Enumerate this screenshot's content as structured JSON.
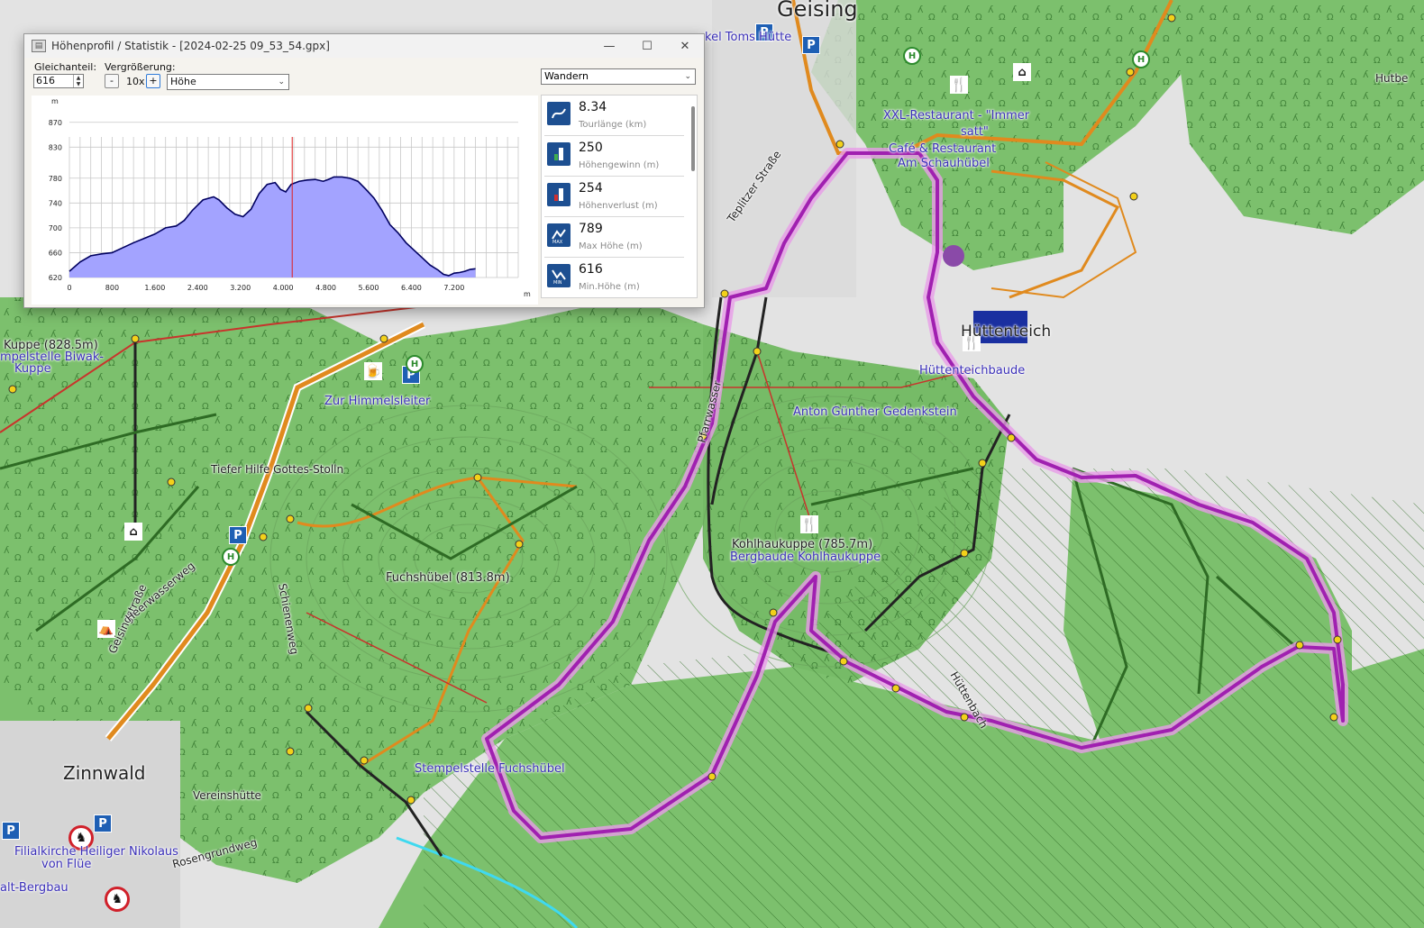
{
  "window": {
    "title": "Höhenprofil / Statistik - [2024-02-25 09_53_54.gpx]",
    "controls": {
      "minimize": "—",
      "maximize": "☐",
      "close": "✕"
    }
  },
  "toolbar": {
    "smoothing_label": "Gleichanteil:",
    "smoothing_value": "616",
    "zoom_label": "Vergrößerung:",
    "zoom_minus": "-",
    "zoom_value": "10x",
    "zoom_plus": "+",
    "axis_select": "Höhe",
    "activity_select": "Wandern"
  },
  "stats": [
    {
      "value": "8.34",
      "label": "Tourlänge (km)",
      "icon": "route-icon"
    },
    {
      "value": "250",
      "label": "Höhengewinn (m)",
      "icon": "elevation-gain-icon"
    },
    {
      "value": "254",
      "label": "Höhenverlust (m)",
      "icon": "elevation-loss-icon"
    },
    {
      "value": "789",
      "label": "Max Höhe (m)",
      "icon": "max-height-icon"
    },
    {
      "value": "616",
      "label": "Min.Höhe (m)",
      "icon": "min-height-icon"
    }
  ],
  "chart_data": {
    "type": "area",
    "title": "",
    "xlabel": "m",
    "ylabel": "m",
    "xlim": [
      0,
      8400
    ],
    "ylim": [
      620,
      890
    ],
    "x_ticks": [
      "0",
      "800",
      "1.600",
      "2.400",
      "3.200",
      "4.000",
      "4.800",
      "5.600",
      "6.400",
      "7.200"
    ],
    "x_tick_values": [
      0,
      800,
      1600,
      2400,
      3200,
      4000,
      4800,
      5600,
      6400,
      7200
    ],
    "y_ticks": [
      "620",
      "660",
      "700",
      "740",
      "780",
      "830",
      "870"
    ],
    "y_tick_values": [
      620,
      660,
      700,
      740,
      780,
      830,
      870
    ],
    "grid": true,
    "cursor_x": 4170,
    "series": [
      {
        "color": "#a3a3ff",
        "x": [
          0,
          80,
          200,
          400,
          600,
          800,
          1000,
          1200,
          1400,
          1600,
          1800,
          2000,
          2150,
          2300,
          2500,
          2700,
          2800,
          2950,
          3100,
          3250,
          3400,
          3550,
          3700,
          3850,
          3950,
          4050,
          4150,
          4300,
          4450,
          4600,
          4750,
          4850,
          4950,
          5100,
          5250,
          5400,
          5550,
          5700,
          5850,
          6000,
          6150,
          6300,
          6450,
          6600,
          6750,
          6900,
          7000,
          7100,
          7200,
          7300,
          7400,
          7500,
          7600
        ],
        "values": [
          630,
          636,
          645,
          655,
          658,
          660,
          668,
          676,
          683,
          690,
          700,
          703,
          712,
          728,
          745,
          750,
          745,
          732,
          722,
          718,
          730,
          755,
          770,
          773,
          762,
          758,
          770,
          775,
          777,
          778,
          775,
          778,
          782,
          782,
          780,
          775,
          762,
          748,
          728,
          705,
          692,
          676,
          664,
          652,
          640,
          632,
          625,
          623,
          627,
          628,
          630,
          633,
          634
        ]
      }
    ]
  },
  "map": {
    "labels": [
      {
        "text": "Geising",
        "cls": "lbl-town"
      },
      {
        "text": "kel Toms Hütte",
        "cls": "lbl-poi"
      },
      {
        "text": "XXL-Restaurant - \"Immer",
        "cls": "lbl-poi"
      },
      {
        "text": "satt\"",
        "cls": "lbl-poi"
      },
      {
        "text": "Café & Restaurant",
        "cls": "lbl-poi"
      },
      {
        "text": "Am Schauhübel",
        "cls": "lbl-poi"
      },
      {
        "text": "Hüttenteich",
        "cls": "lbl-town-s"
      },
      {
        "text": "Hüttenteichbaude",
        "cls": "lbl-poi"
      },
      {
        "text": "Anton Günther Gedenkstein",
        "cls": "lbl-poi"
      },
      {
        "text": "Kohlhaukuppe (785.7m)",
        "cls": "lbl-peak"
      },
      {
        "text": "Bergbaude Kohlhaukuppe",
        "cls": "lbl-poi"
      },
      {
        "text": "Fuchshübel (813.8m)",
        "cls": "lbl-peak"
      },
      {
        "text": "Stempelstelle Fuchshübel",
        "cls": "lbl-poi"
      },
      {
        "text": "Zur Himmelsleiter",
        "cls": "lbl-poi"
      },
      {
        "text": "Tiefer Hilfe Gottes-Stolln",
        "cls": "lbl-small"
      },
      {
        "text": "Kuppe (828.5m)",
        "cls": "lbl-peak"
      },
      {
        "text": "mpelstelle Biwak-",
        "cls": "lbl-poi"
      },
      {
        "text": "Kuppe",
        "cls": "lbl-poi"
      },
      {
        "text": "Zinnwald",
        "cls": "lbl-town"
      },
      {
        "text": "Vereinshütte",
        "cls": "lbl-small"
      },
      {
        "text": "Filialkirche Heiliger Nikolaus",
        "cls": "lbl-poi"
      },
      {
        "text": "von Flüe",
        "cls": "lbl-poi"
      },
      {
        "text": "alt-Bergbau",
        "cls": "lbl-poi"
      },
      {
        "text": "Hutbe",
        "cls": "lbl-small"
      },
      {
        "text": "Teplitzer Straße",
        "cls": "lbl-small"
      },
      {
        "text": "Geisingstraße",
        "cls": "lbl-small"
      },
      {
        "text": "Schienenweg",
        "cls": "lbl-small"
      },
      {
        "text": "Hüttenbach",
        "cls": "lbl-small"
      },
      {
        "text": "Rosengrundweg",
        "cls": "lbl-small"
      },
      {
        "text": "Heerwasserweg",
        "cls": "lbl-small"
      },
      {
        "text": "Pfarrwasser",
        "cls": "lbl-small"
      }
    ],
    "colors": {
      "forest": "#7cc06d",
      "forest_dark": "#6db05f",
      "open": "#e2e2e2",
      "route": "#d23cd2",
      "road_orange": "#e08a1e",
      "road_red": "#c8342c",
      "track_green": "#2e6b24",
      "poi_blue": "#3a2fb8",
      "water": "#3fd9ef"
    }
  }
}
